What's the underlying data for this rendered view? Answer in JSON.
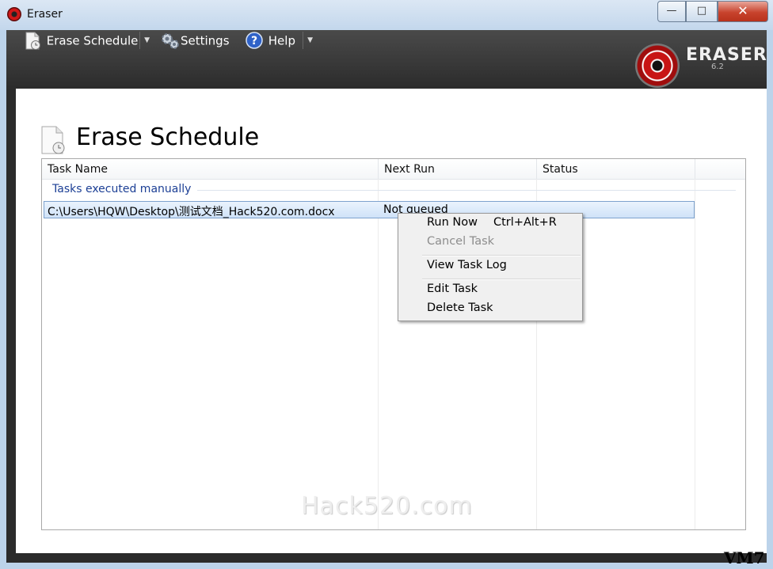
{
  "window": {
    "title": "Eraser"
  },
  "toolbar": {
    "erase_schedule": "Erase Schedule",
    "settings": "Settings",
    "help": "Help"
  },
  "logo": {
    "name": "ERASER",
    "version": "6.2"
  },
  "page": {
    "title": "Erase Schedule"
  },
  "columns": [
    "Task Name",
    "Next Run",
    "Status"
  ],
  "group": {
    "label": "Tasks executed manually"
  },
  "rows": [
    {
      "task_name": "C:\\Users\\HQW\\Desktop\\测试文档_Hack520.com.docx",
      "next_run": "Not queued",
      "status": ""
    }
  ],
  "context_menu": {
    "run_now": "Run Now",
    "run_now_shortcut": "Ctrl+Alt+R",
    "cancel_task": "Cancel Task",
    "view_task_log": "View Task Log",
    "edit_task": "Edit Task",
    "delete_task": "Delete Task"
  },
  "watermark": "Hack520.com",
  "vm_label": "VM7",
  "colors": {
    "accent": "#c81414",
    "selection": "#cfe2f8",
    "group_text": "#1c3f95"
  }
}
